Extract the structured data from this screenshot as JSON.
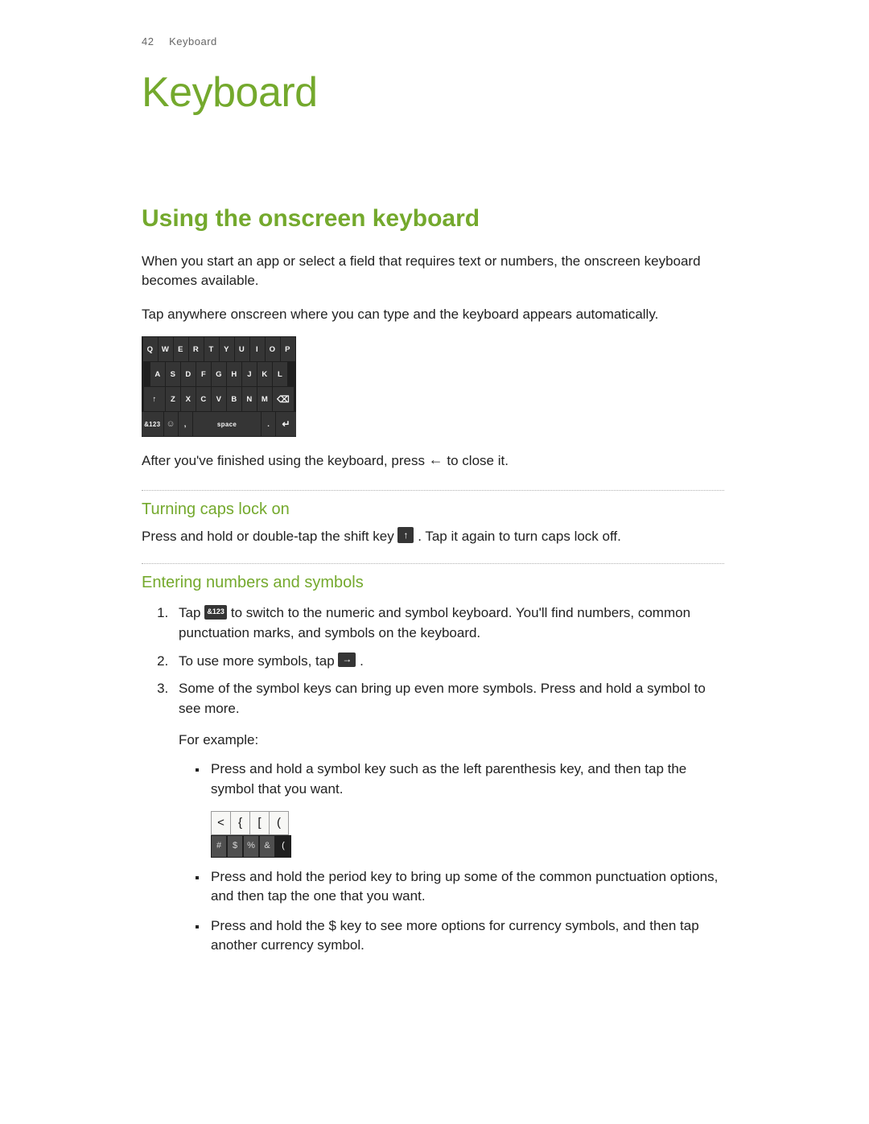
{
  "header": {
    "page_number": "42",
    "section": "Keyboard"
  },
  "title": "Keyboard",
  "heading": "Using the onscreen keyboard",
  "intro_p1": "When you start an app or select a field that requires text or numbers, the onscreen keyboard becomes available.",
  "intro_p2": "Tap anywhere onscreen where you can type and the keyboard appears automatically.",
  "keyboard": {
    "row1": [
      "Q",
      "W",
      "E",
      "R",
      "T",
      "Y",
      "U",
      "I",
      "O",
      "P"
    ],
    "row2": [
      "A",
      "S",
      "D",
      "F",
      "G",
      "H",
      "J",
      "K",
      "L"
    ],
    "shift": "↑",
    "row3": [
      "Z",
      "X",
      "C",
      "V",
      "B",
      "N",
      "M"
    ],
    "back": "⌫",
    "num": "&123",
    "emoji": "☺",
    "comma": ",",
    "space": "space",
    "period": ".",
    "enter": "↵"
  },
  "after_kb_pre": "After you've finished using the keyboard, press ",
  "after_kb_glyph": "←",
  "after_kb_post": " to close it.",
  "sub1": {
    "title": "Turning caps lock on",
    "pre": "Press and hold or double-tap the shift key ",
    "glyph": "↑",
    "post": ". Tap it again to turn caps lock off."
  },
  "sub2": {
    "title": "Entering numbers and symbols",
    "items": [
      {
        "pre": "Tap ",
        "key": "&123",
        "post": " to switch to the numeric and symbol keyboard. You'll find numbers, common punctuation marks, and symbols on the keyboard."
      },
      {
        "pre": "To use more symbols, tap ",
        "key": "→",
        "post": "."
      },
      {
        "text": "Some of the symbol keys can bring up even more symbols. Press and hold a symbol to see more.",
        "example_label": "For example:",
        "bullets": [
          "Press and hold a symbol key such as the left parenthesis key, and then tap the symbol that you want.",
          "Press and hold the period key to bring up some of the common punctuation options, and then tap the one that you want.",
          "Press and hold the $ key to see more options for currency symbols, and then tap another currency symbol."
        ],
        "example_kb": {
          "top": [
            "<",
            "{",
            "[",
            "("
          ],
          "bottom": [
            "#",
            "$",
            "%",
            "&",
            "("
          ]
        }
      }
    ]
  }
}
